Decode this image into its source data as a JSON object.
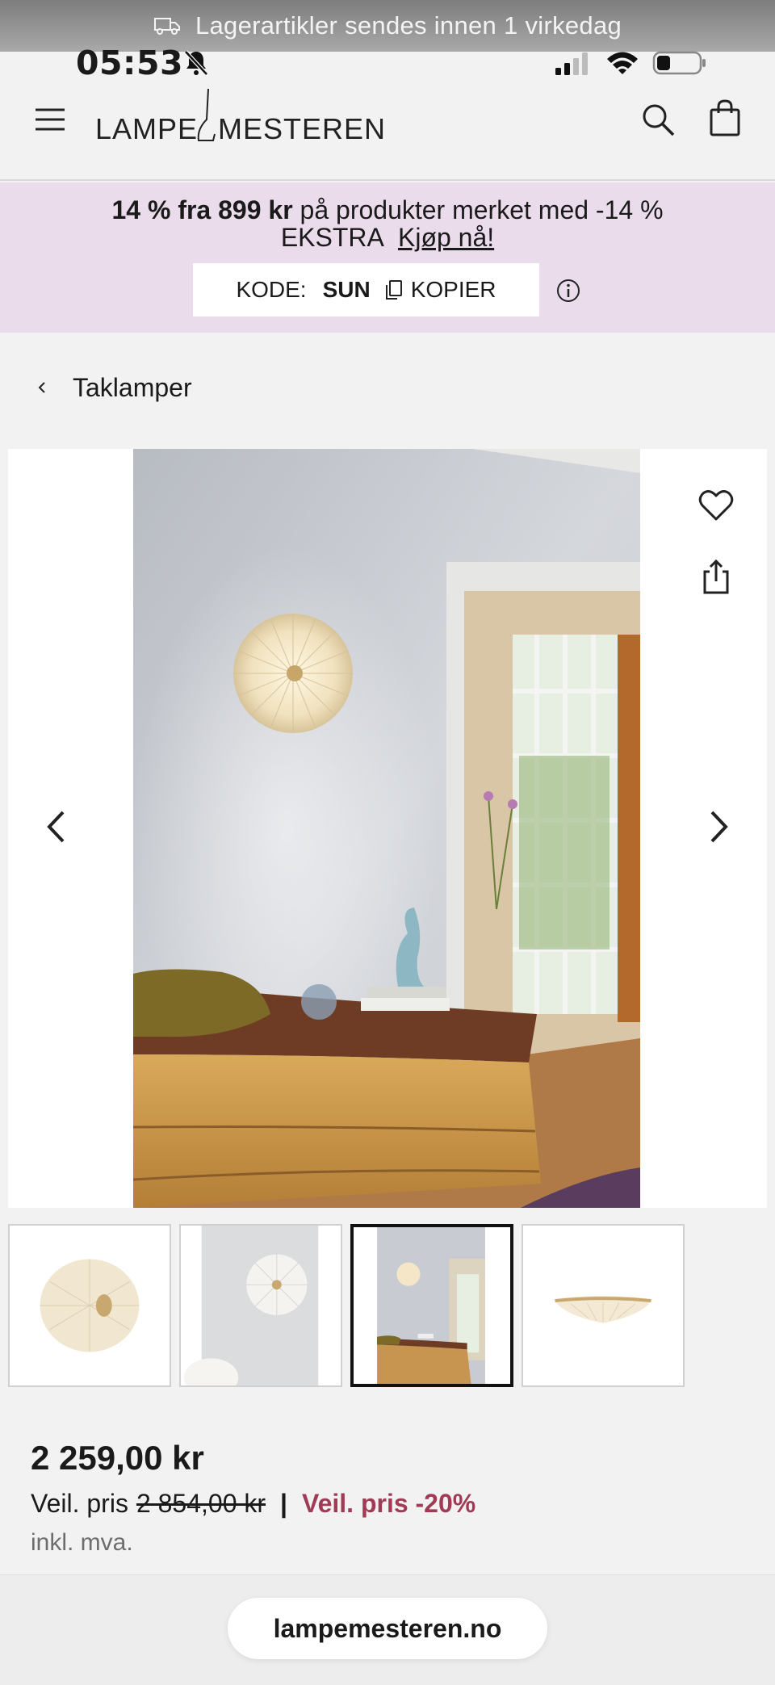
{
  "shipping_banner": {
    "text": "Lagerartikler sendes innen 1 virkedag",
    "icon": "truck-icon"
  },
  "status_bar": {
    "time": "05:53"
  },
  "header": {
    "logo_text_left": "LAMPE",
    "logo_text_right": "MESTEREN"
  },
  "promo": {
    "line1_bold": "14 % fra 899 kr",
    "line1_rest": " på produkter merket med -14 %",
    "line2_text": "EKSTRA",
    "buy_link": "Kjøp nå!",
    "code_label": "KODE:",
    "code_value": "SUN",
    "copy_label": "KOPIER",
    "background": "#ebdcec"
  },
  "breadcrumb": {
    "label": "Taklamper"
  },
  "gallery": {
    "thumbnail_count": 4,
    "active_thumbnail": 3
  },
  "product": {
    "price": "2 259,00 kr",
    "orig_label": "Veil. pris",
    "orig_price": "2 854,00 kr",
    "separator": "|",
    "discount": "Veil. pris -20%",
    "vat": "inkl. mva.",
    "discount_color": "#a03a55"
  },
  "browser": {
    "url": "lampemesteren.no"
  }
}
